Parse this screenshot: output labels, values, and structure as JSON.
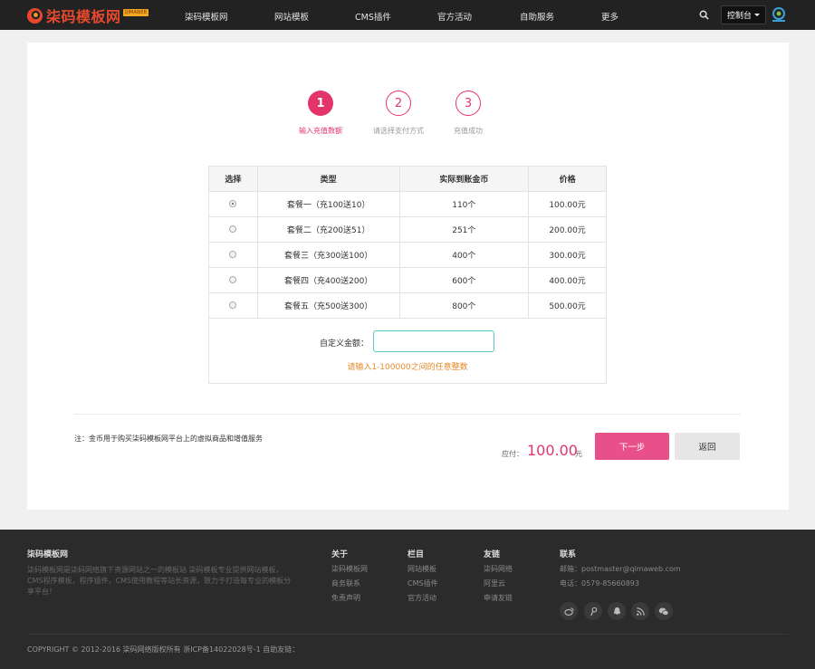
{
  "header": {
    "logo_text": "柒码模板网",
    "logo_badge": "QIMAWEB",
    "nav": [
      "柒码模板网",
      "网站模板",
      "CMS插件",
      "官方活动",
      "自助服务",
      "更多"
    ],
    "console_label": "控制台"
  },
  "steps": [
    {
      "number": "1",
      "label": "输入充值数额",
      "active": true
    },
    {
      "number": "2",
      "label": "请选择支付方式",
      "active": false
    },
    {
      "number": "3",
      "label": "充值成功",
      "active": false
    }
  ],
  "table": {
    "headers": [
      "选择",
      "类型",
      "实际到账金币",
      "价格"
    ],
    "rows": [
      {
        "type": "套餐一（充100送10）",
        "coins": "110个",
        "price": "100.00元",
        "selected": true
      },
      {
        "type": "套餐二（充200送51）",
        "coins": "251个",
        "price": "200.00元",
        "selected": false
      },
      {
        "type": "套餐三（充300送100）",
        "coins": "400个",
        "price": "300.00元",
        "selected": false
      },
      {
        "type": "套餐四（充400送200）",
        "coins": "600个",
        "price": "400.00元",
        "selected": false
      },
      {
        "type": "套餐五（充500送300）",
        "coins": "800个",
        "price": "500.00元",
        "selected": false
      }
    ]
  },
  "custom": {
    "label": "自定义金额：",
    "value": "",
    "hint": "请输入1-100000之间的任意整数"
  },
  "summary": {
    "note": "注：金币用于购买柒码模板网平台上的虚拟商品和增值服务",
    "pay_label": "应付：",
    "amount": "100.00",
    "unit": "元",
    "next_label": "下一步",
    "back_label": "返回"
  },
  "footer": {
    "brand": "柒码模板网",
    "desc": "柒码模板网是柒码网络旗下资源网站之一的模板站 柒码模板专业提供网站模板，CMS程序模板，程序插件，CMS使用教程等站长资源，致力于打造每专业的模板分享平台！",
    "columns": [
      {
        "title": "关于",
        "links": [
          "柒码模板网",
          "商务联系",
          "免责声明"
        ]
      },
      {
        "title": "栏目",
        "links": [
          "网站模板",
          "CMS插件",
          "官方活动"
        ]
      },
      {
        "title": "友链",
        "links": [
          "柒码网络",
          "阿里云",
          "申请友链"
        ]
      }
    ],
    "contact_title": "联系",
    "email": "邮箱：postmaster@qimaweb.com",
    "phone": "电话：0579-85660893",
    "social_icons": [
      "weibo-icon",
      "tencent-weibo-icon",
      "qq-icon",
      "rss-icon",
      "wechat-icon"
    ],
    "copyright": "COPYRIGHT © 2012-2016 柒码网络版权所有 浙ICP备14022028号-1 自助友链："
  },
  "colors": {
    "accent": "#e4356b",
    "logo": "#e8492e",
    "hint": "#e8892a",
    "header_bg": "#222222",
    "footer_bg": "#2b2b2b"
  }
}
